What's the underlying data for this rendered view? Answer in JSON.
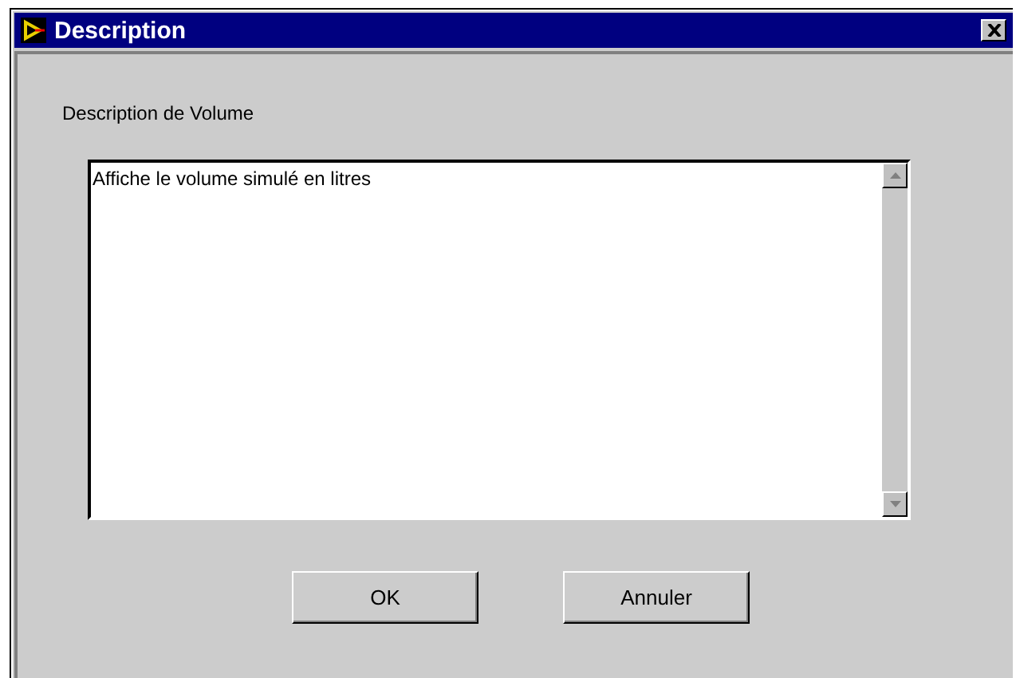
{
  "window": {
    "title": "Description"
  },
  "label": "Description de Volume",
  "description": {
    "value": "Affiche le volume simulé en litres"
  },
  "buttons": [
    "OK",
    "Annuler"
  ]
}
